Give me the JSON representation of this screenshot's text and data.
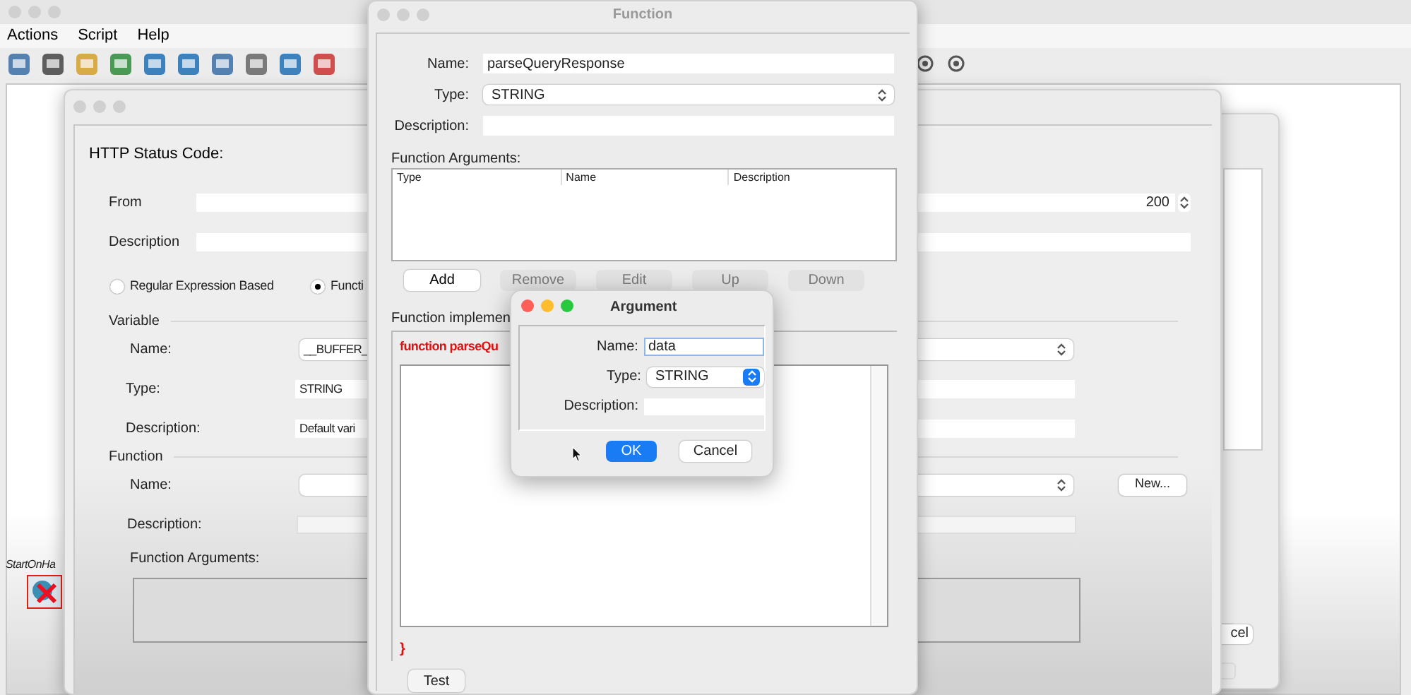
{
  "app": {
    "menu": [
      "Actions",
      "Script",
      "Help"
    ],
    "node_label": "StartOnHa"
  },
  "back_window": {
    "button": "cel"
  },
  "http_window": {
    "active": false,
    "status_label": "HTTP Status Code:",
    "from_label": "From",
    "from_value": "200",
    "description_label": "Description",
    "radios": [
      {
        "label": "Regular Expression Based",
        "selected": false
      },
      {
        "label": "Functi",
        "selected": true
      }
    ],
    "variable": {
      "heading": "Variable",
      "name_label": "Name:",
      "name_value": "__BUFFER_",
      "type_label": "Type:",
      "type_value": "STRING",
      "description_label": "Description:",
      "description_value": "Default vari"
    },
    "function": {
      "heading": "Function",
      "name_label": "Name:",
      "new_button": "New...",
      "description_label": "Description:",
      "arguments_label": "Function Arguments:"
    }
  },
  "function_window": {
    "active": false,
    "title": "Function",
    "name_label": "Name:",
    "name_value": "parseQueryResponse",
    "type_label": "Type:",
    "type_value": "STRING",
    "description_label": "Description:",
    "arguments_label": "Function Arguments:",
    "columns": [
      "Type",
      "Name",
      "Description"
    ],
    "buttons": [
      {
        "label": "Add",
        "disabled": false
      },
      {
        "label": "Remove",
        "disabled": true
      },
      {
        "label": "Edit",
        "disabled": true
      },
      {
        "label": "Up",
        "disabled": true
      },
      {
        "label": "Down",
        "disabled": true
      }
    ],
    "implementation_label": "Function implemen",
    "code_head": "function parseQu",
    "code_tail": "}",
    "test_button": "Test"
  },
  "argument_dialog": {
    "active": true,
    "title": "Argument",
    "name_label": "Name:",
    "name_value": "data",
    "type_label": "Type:",
    "type_value": "STRING",
    "description_label": "Description:",
    "ok_button": "OK",
    "cancel_button": "Cancel"
  }
}
